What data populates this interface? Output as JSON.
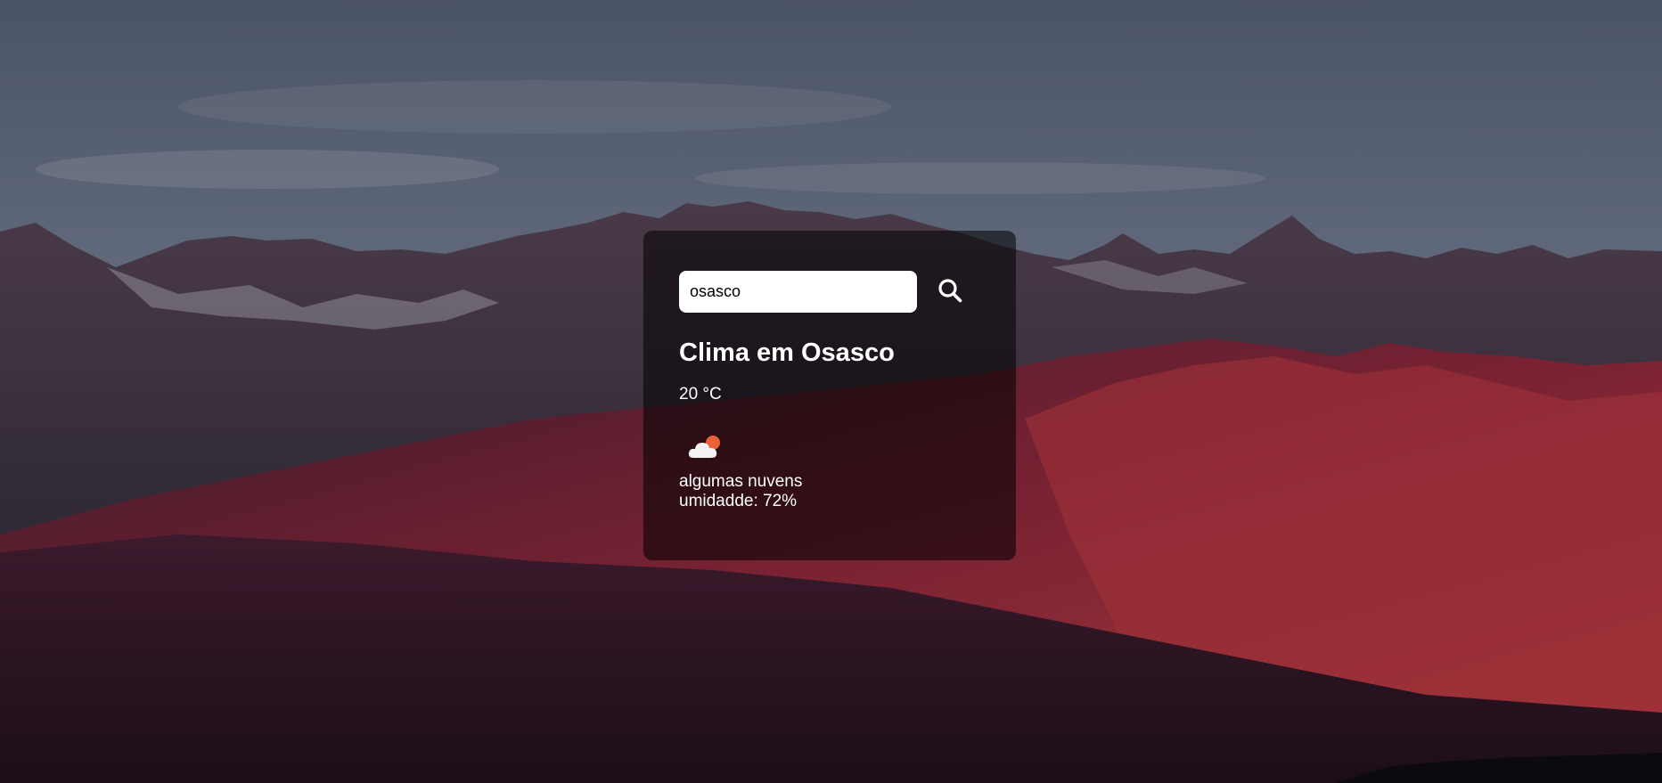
{
  "search": {
    "value": "osasco",
    "icon": "search-icon"
  },
  "weather": {
    "title": "Clima em Osasco",
    "temperature": "20 °C",
    "icon": "few-clouds-icon",
    "description": "algumas nuvens",
    "humidity": "umidadde: 72%"
  },
  "colors": {
    "card_background": "rgba(0,0,0,0.55)",
    "input_background": "#ffffff",
    "text": "#ffffff",
    "sky": "#4a5468",
    "mountain_red": "#8e2a3a",
    "sun": "#e8623a"
  }
}
